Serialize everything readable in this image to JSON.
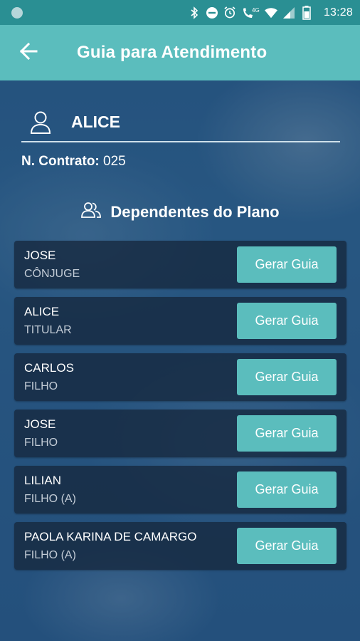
{
  "status_bar": {
    "time": "13:28",
    "network": "4G",
    "icons": [
      "bluetooth-icon",
      "do-not-disturb-icon",
      "alarm-icon",
      "call-icon",
      "wifi-icon",
      "signal-icon",
      "battery-icon"
    ]
  },
  "app_bar": {
    "title": "Guia para Atendimento",
    "back_icon": "arrow-left-icon"
  },
  "user": {
    "name": "ALICE",
    "contract_label": "N. Contrato:",
    "contract_value": "025"
  },
  "section": {
    "title": "Dependentes do Plano"
  },
  "dependents": [
    {
      "name": "JOSE",
      "relation": "CÔNJUGE",
      "button": "Gerar Guia"
    },
    {
      "name": "ALICE",
      "relation": "TITULAR",
      "button": "Gerar Guia"
    },
    {
      "name": "CARLOS",
      "relation": "FILHO",
      "button": "Gerar Guia"
    },
    {
      "name": "JOSE",
      "relation": "FILHO",
      "button": "Gerar Guia"
    },
    {
      "name": "LILIAN",
      "relation": "FILHO (A)",
      "button": "Gerar Guia"
    },
    {
      "name": "PAOLA KARINA DE CAMARGO",
      "relation": "FILHO (A)",
      "button": "Gerar Guia"
    }
  ],
  "colors": {
    "accent": "#5bbdbd",
    "status_bar": "#2a8f93",
    "card_bg": "#16283e"
  }
}
